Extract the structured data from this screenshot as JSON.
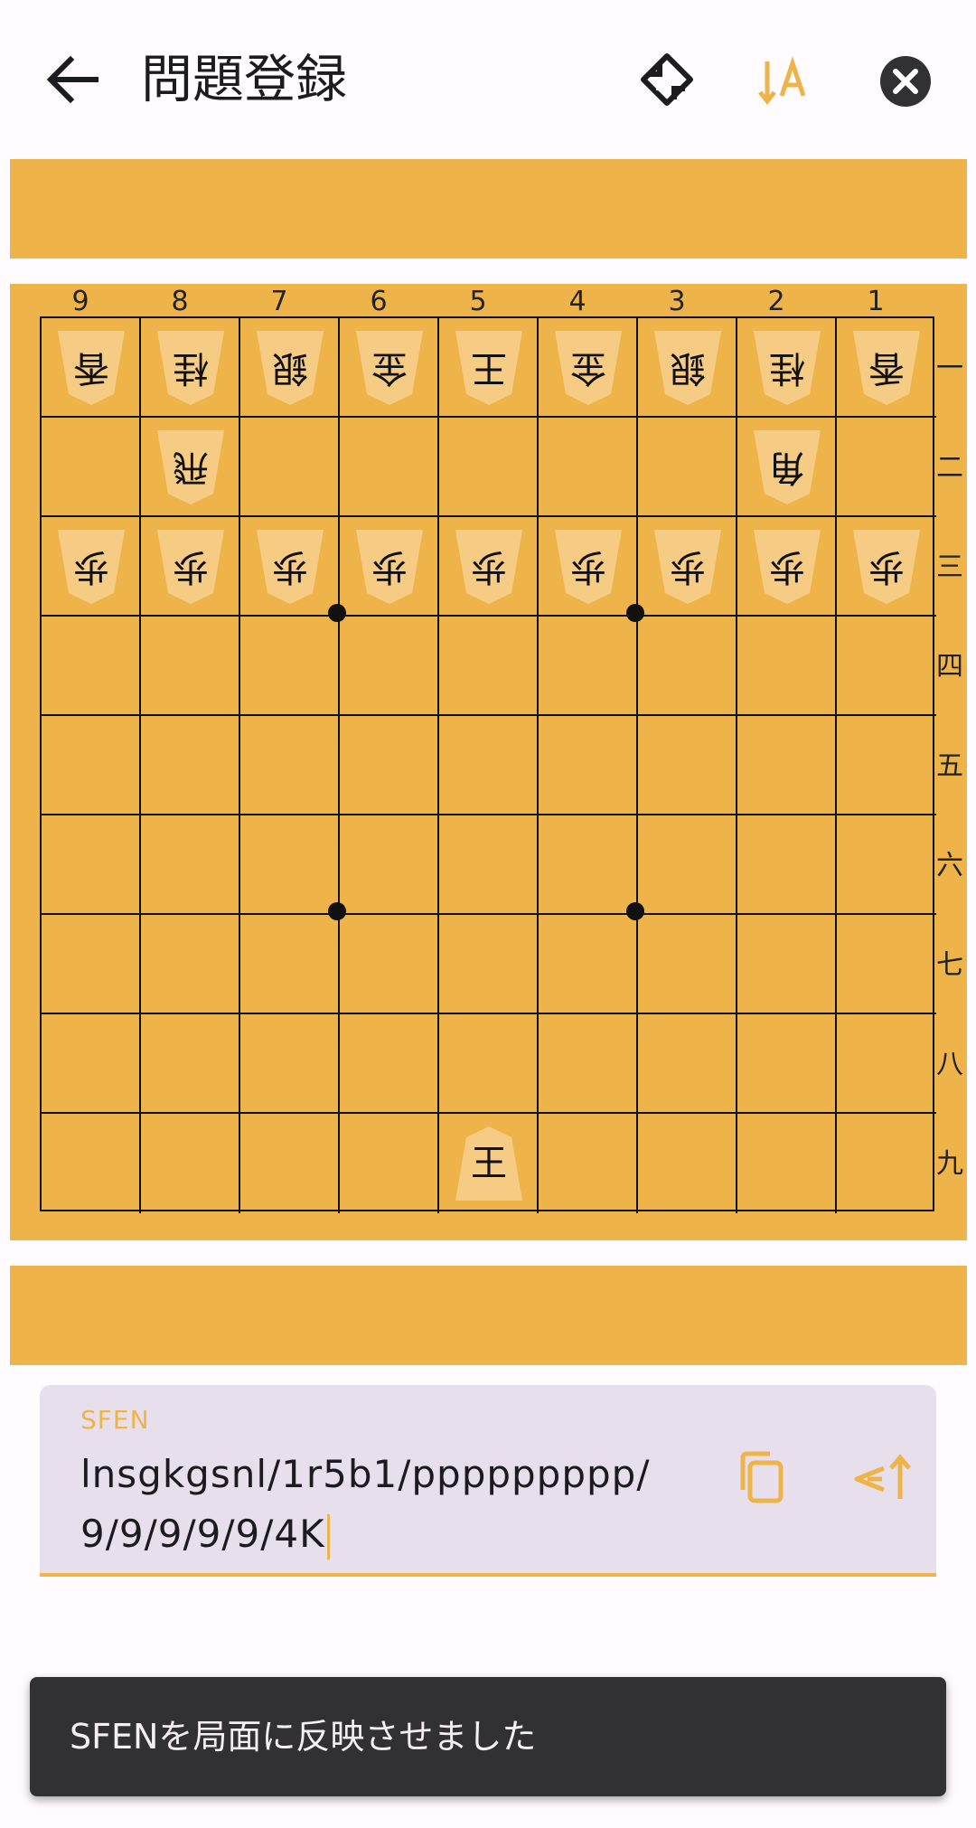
{
  "appbar": {
    "title": "問題登録",
    "back_icon": "arrow-back-icon",
    "flip_icon": "flip-board-icon",
    "sort_icon": "sort-direction-icon",
    "close_icon": "close-circle-icon"
  },
  "colors": {
    "accent": "#efb449",
    "board": "#efb449",
    "piece_face": "#f6cc85",
    "field_bg": "#e7e0ec",
    "snackbar_bg": "#313033"
  },
  "board": {
    "column_numbers": [
      "9",
      "8",
      "7",
      "6",
      "5",
      "4",
      "3",
      "2",
      "1"
    ],
    "row_numbers": [
      "一",
      "二",
      "三",
      "四",
      "五",
      "六",
      "七",
      "八",
      "九"
    ],
    "rows": [
      [
        {
          "k": "香",
          "side": "gote"
        },
        {
          "k": "桂",
          "side": "gote"
        },
        {
          "k": "銀",
          "side": "gote"
        },
        {
          "k": "金",
          "side": "gote"
        },
        {
          "k": "王",
          "side": "gote"
        },
        {
          "k": "金",
          "side": "gote"
        },
        {
          "k": "銀",
          "side": "gote"
        },
        {
          "k": "桂",
          "side": "gote"
        },
        {
          "k": "香",
          "side": "gote"
        }
      ],
      [
        null,
        {
          "k": "飛",
          "side": "gote"
        },
        null,
        null,
        null,
        null,
        null,
        {
          "k": "角",
          "side": "gote"
        },
        null
      ],
      [
        {
          "k": "歩",
          "side": "gote"
        },
        {
          "k": "歩",
          "side": "gote"
        },
        {
          "k": "歩",
          "side": "gote"
        },
        {
          "k": "歩",
          "side": "gote"
        },
        {
          "k": "歩",
          "side": "gote"
        },
        {
          "k": "歩",
          "side": "gote"
        },
        {
          "k": "歩",
          "side": "gote"
        },
        {
          "k": "歩",
          "side": "gote"
        },
        {
          "k": "歩",
          "side": "gote"
        }
      ],
      [
        null,
        null,
        null,
        null,
        null,
        null,
        null,
        null,
        null
      ],
      [
        null,
        null,
        null,
        null,
        null,
        null,
        null,
        null,
        null
      ],
      [
        null,
        null,
        null,
        null,
        null,
        null,
        null,
        null,
        null
      ],
      [
        null,
        null,
        null,
        null,
        null,
        null,
        null,
        null,
        null
      ],
      [
        null,
        null,
        null,
        null,
        null,
        null,
        null,
        null,
        null
      ],
      [
        null,
        null,
        null,
        null,
        {
          "k": "王",
          "side": "sente"
        },
        null,
        null,
        null,
        null
      ]
    ]
  },
  "sfen_field": {
    "label": "SFEN",
    "value": "lnsgkgsnl/1r5b1/ppppppppp/9/9/9/9/9/4K",
    "copy_icon": "copy-icon",
    "apply_icon": "apply-sfen-icon"
  },
  "snackbar": {
    "message": "SFENを局面に反映させました"
  }
}
